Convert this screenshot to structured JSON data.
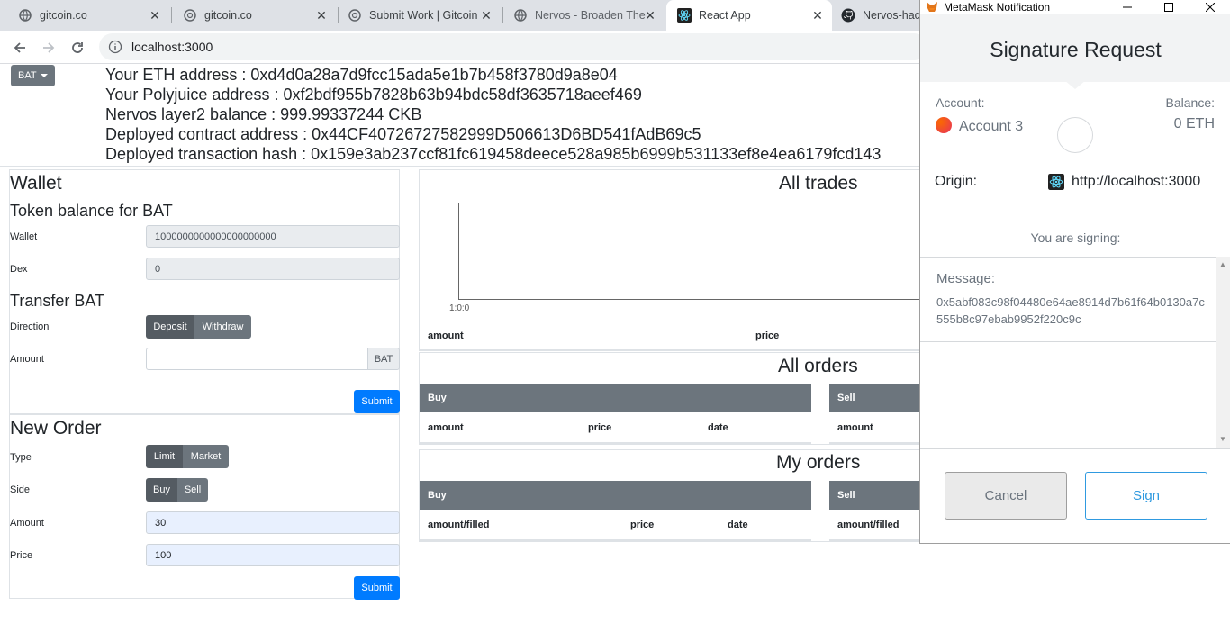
{
  "browser": {
    "tabs": [
      {
        "title": "gitcoin.co",
        "active": false,
        "icon": "globe-icon"
      },
      {
        "title": "gitcoin.co",
        "active": false,
        "icon": "gitcoin-icon"
      },
      {
        "title": "Submit Work | Gitcoin",
        "active": false,
        "icon": "gitcoin-icon"
      },
      {
        "title": "Nervos - Broaden The",
        "active": false,
        "icon": "globe-icon"
      },
      {
        "title": "React App",
        "active": true,
        "icon": "react-icon"
      },
      {
        "title": "Nervos-hac",
        "active": false,
        "icon": "github-icon"
      }
    ],
    "url": "localhost:3000"
  },
  "header": {
    "token_dropdown": "BAT",
    "eth_address": "Your ETH address : 0xd4d0a28a7d9fcc15ada5e1b7b458f3780d9a8e04",
    "polyjuice_address": "Your Polyjuice address : 0xf2bdf955b7828b63b94bdc58df3635718aeef469",
    "layer2_balance": "Nervos layer2 balance : 999.99337244 CKB",
    "contract_address": "Deployed contract address : 0x44CF40726727582999D506613D6BD541fAdB69c5",
    "tx_hash": "Deployed transaction hash : 0x159e3ab237ccf81fc619458deece528a985b6999b531133ef8e4ea6179fcd143"
  },
  "wallet": {
    "title": "Wallet",
    "balance_title": "Token balance for BAT",
    "wallet_label": "Wallet",
    "wallet_value": "1000000000000000000000",
    "dex_label": "Dex",
    "dex_value": "0",
    "transfer_title": "Transfer BAT",
    "direction_label": "Direction",
    "deposit": "Deposit",
    "withdraw": "Withdraw",
    "amount_label": "Amount",
    "amount_addon": "BAT",
    "submit": "Submit"
  },
  "new_order": {
    "title": "New Order",
    "type_label": "Type",
    "limit": "Limit",
    "market": "Market",
    "side_label": "Side",
    "buy": "Buy",
    "sell": "Sell",
    "amount_label": "Amount",
    "amount_value": "30",
    "price_label": "Price",
    "price_value": "100",
    "submit": "Submit"
  },
  "all_trades": {
    "title": "All trades",
    "chart_tick": "1:0:0",
    "col_amount": "amount",
    "col_price": "price"
  },
  "all_orders": {
    "title": "All orders",
    "buy": "Buy",
    "sell": "Sell",
    "col_amount": "amount",
    "col_price": "price",
    "col_date": "date",
    "col_amount_sell": "amount"
  },
  "my_orders": {
    "title": "My orders",
    "buy": "Buy",
    "sell": "Sell",
    "col_amount": "amount/filled",
    "col_price": "price",
    "col_date": "date",
    "col_amount_sell": "amount/filled"
  },
  "metamask": {
    "window_title": "MetaMask Notification",
    "header": "Signature Request",
    "account_label": "Account:",
    "account_name": "Account 3",
    "balance_label": "Balance:",
    "balance_value": "0 ETH",
    "origin_label": "Origin:",
    "origin_value": "http://localhost:3000",
    "signing_label": "You are signing:",
    "message_label": "Message:",
    "message_value": "0x5abf083c98f04480e64ae8914d7b61f64b0130a7c555b8c97ebab9952f220c9c",
    "cancel": "Cancel",
    "sign": "Sign"
  },
  "colors": {
    "primary": "#007bff",
    "secondary": "#6c757d",
    "metamask_blue": "#2f9ae0"
  }
}
